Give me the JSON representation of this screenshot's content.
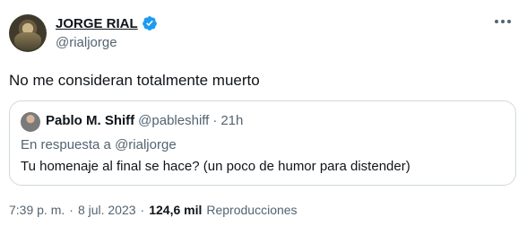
{
  "author": {
    "display_name": "JORGE RIAL",
    "handle": "@rialjorge"
  },
  "tweet": {
    "text": "No me consideran totalmente muerto"
  },
  "quoted_tweet": {
    "display_name": "Pablo M. Shiff",
    "handle": "@pableshiff",
    "separator": "·",
    "time": "21h",
    "reply_prefix": "En respuesta a",
    "reply_to": "@rialjorge",
    "text": "Tu homenaje al final se hace? (un poco de humor para distender)"
  },
  "meta": {
    "time": "7:39 p. m.",
    "dot1": "·",
    "date": "8 jul. 2023",
    "dot2": "·",
    "views_count": "124,6 mil",
    "views_label": "Reproducciones"
  },
  "colors": {
    "verified_blue": "#1d9bf0",
    "secondary_text": "#536471",
    "border": "#cfd9de"
  },
  "icons": [
    "verified-badge-icon",
    "more-options-icon"
  ]
}
